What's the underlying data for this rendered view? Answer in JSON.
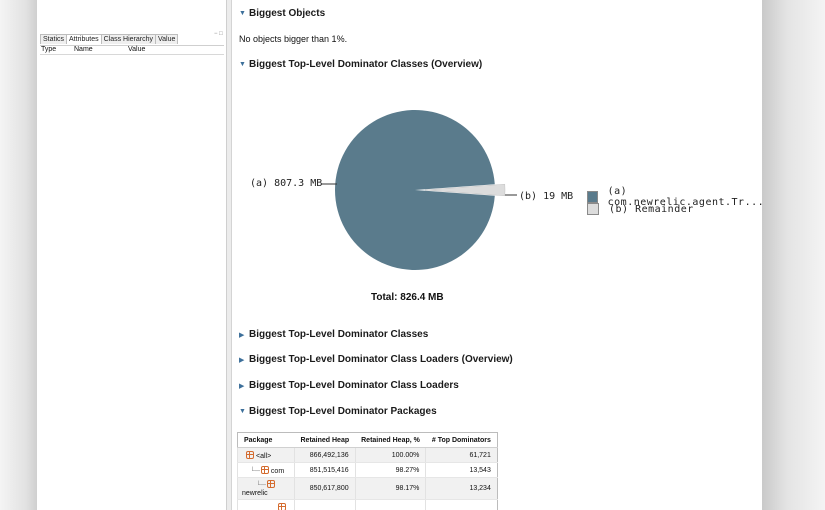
{
  "left_panel": {
    "tabs": [
      "Statics",
      "Attributes",
      "Class Hierarchy",
      "Value"
    ],
    "active_tab": "Attributes",
    "tab_controls": "− □",
    "columns": [
      "Type",
      "Name",
      "Value"
    ]
  },
  "sections": {
    "biggest_objects": "Biggest Objects",
    "biggest_objects_note": "No objects bigger than 1%.",
    "dominator_classes_overview": "Biggest Top-Level Dominator Classes (Overview)",
    "dominator_classes": "Biggest Top-Level Dominator Classes",
    "dominator_class_loaders_overview": "Biggest Top-Level Dominator Class Loaders (Overview)",
    "dominator_class_loaders": "Biggest Top-Level Dominator Class Loaders",
    "dominator_packages": "Biggest Top-Level Dominator Packages"
  },
  "chart_data": {
    "type": "pie",
    "total_label": "Total: 826.4 MB",
    "slices": [
      {
        "key": "a",
        "label": "(a)  807.3 MB",
        "value": 807.3,
        "legend": "(a)  com.newrelic.agent.Tr...",
        "color": "#5a7b8c"
      },
      {
        "key": "b",
        "label": "(b)  19 MB",
        "value": 19,
        "legend": "(b)  Remainder",
        "color": "#dcdcdc"
      }
    ]
  },
  "table": {
    "headers": [
      "Package",
      "Retained Heap",
      "Retained Heap, %",
      "# Top Dominators"
    ],
    "rows": [
      {
        "package": "<all>",
        "retained": "866,492,136",
        "percent": "100.00%",
        "dominators": "61,721"
      },
      {
        "package": "com",
        "retained": "851,515,416",
        "percent": "98.27%",
        "dominators": "13,543"
      },
      {
        "package": "newrelic",
        "retained": "850,617,800",
        "percent": "98.17%",
        "dominators": "13,234"
      }
    ]
  },
  "colors": {
    "section_triangle": "#3c6f9a",
    "pie_main": "#5a7b8c",
    "pie_remainder": "#dcdcdc",
    "package_icon": "#d46b2e"
  }
}
